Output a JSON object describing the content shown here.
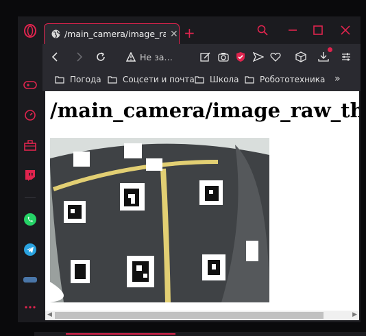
{
  "browser": {
    "accent": "#e0244e",
    "tab": {
      "title": "/main_camera/image_raw_t",
      "close": "✕"
    },
    "new_tab": "+",
    "address": "Не за…",
    "bookmarks": [
      "Погода",
      "Соцсети и почта",
      "Школа",
      "Робототехника"
    ],
    "bookmarks_more": "»"
  },
  "page": {
    "heading": "/main_camera/image_raw_thrott"
  },
  "sidebar": {
    "items": [
      "gamepad-icon",
      "speedometer-icon",
      "briefcase-icon",
      "twitch-icon",
      "whatsapp-icon",
      "telegram-icon",
      "more-icon"
    ]
  }
}
